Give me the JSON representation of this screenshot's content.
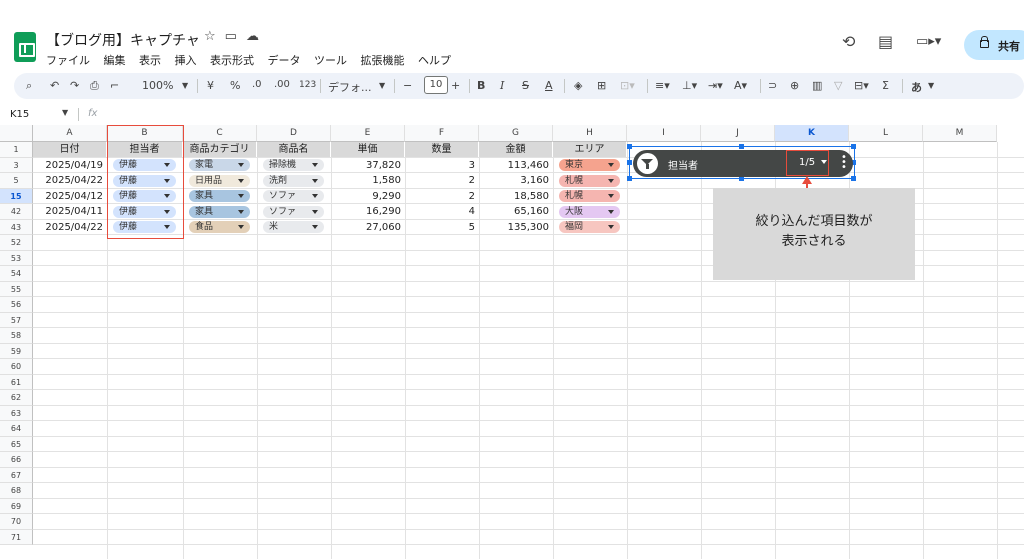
{
  "document": {
    "title": "【ブログ用】キャプチャ"
  },
  "menu": [
    "ファイル",
    "編集",
    "表示",
    "挿入",
    "表示形式",
    "データ",
    "ツール",
    "拡張機能",
    "ヘルプ"
  ],
  "share_label": "共有",
  "toolbar": {
    "zoom": "100%",
    "currency": "¥",
    "percent": "%",
    "dec_minus": ".0",
    "dec_plus": ".00",
    "number_format": "123",
    "font": "デフォ...",
    "font_size": "10",
    "input_method": "あ"
  },
  "formula_bar": {
    "name_box": "K15",
    "fx": "fx",
    "formula": ""
  },
  "columns": [
    "A",
    "B",
    "C",
    "D",
    "E",
    "F",
    "G",
    "H",
    "I",
    "J",
    "K",
    "L",
    "M"
  ],
  "selected_column": "K",
  "selected_row": "15",
  "row_numbers": [
    "1",
    "3",
    "5",
    "15",
    "42",
    "43",
    "52",
    "53",
    "54",
    "55",
    "56",
    "57",
    "58",
    "59",
    "60",
    "61",
    "62",
    "63",
    "64",
    "65",
    "66",
    "67",
    "68",
    "69",
    "70",
    "71"
  ],
  "table": {
    "headers": [
      "日付",
      "担当者",
      "商品カテゴリ",
      "商品名",
      "単価",
      "数量",
      "金額",
      "エリア"
    ],
    "rows": [
      {
        "date": "2025/04/19",
        "person": "伊藤",
        "category": "家電",
        "product": "掃除機",
        "price": "37,820",
        "qty": "3",
        "amount": "113,460",
        "area": "東京"
      },
      {
        "date": "2025/04/22",
        "person": "伊藤",
        "category": "日用品",
        "product": "洗剤",
        "price": "1,580",
        "qty": "2",
        "amount": "3,160",
        "area": "札幌"
      },
      {
        "date": "2025/04/12",
        "person": "伊藤",
        "category": "家具",
        "product": "ソファ",
        "price": "9,290",
        "qty": "2",
        "amount": "18,580",
        "area": "札幌"
      },
      {
        "date": "2025/04/11",
        "person": "伊藤",
        "category": "家具",
        "product": "ソファ",
        "price": "16,290",
        "qty": "4",
        "amount": "65,160",
        "area": "大阪"
      },
      {
        "date": "2025/04/22",
        "person": "伊藤",
        "category": "食品",
        "product": "米",
        "price": "27,060",
        "qty": "5",
        "amount": "135,300",
        "area": "福岡"
      }
    ]
  },
  "chip_colors": {
    "person": "#d3e3fd",
    "category": {
      "家電": "#c9d7e8",
      "日用品": "#f0e9dc",
      "家具": "#a8c5e0",
      "食品": "#e3d0b8"
    },
    "product": "#e8eaed",
    "area": {
      "東京": "#f5a38e",
      "札幌": "#f5b5b0",
      "大阪": "#e4c8f2",
      "福岡": "#f7c6c0"
    }
  },
  "filter_chip": {
    "label": "担当者",
    "count": "1/5"
  },
  "callout": {
    "line1": "絞り込んだ項目数が",
    "line2": "表示される"
  },
  "accent_colors": {
    "highlight_box": "#e74c3c",
    "selection": "#1a73e8",
    "logo": "#0f9d58"
  }
}
